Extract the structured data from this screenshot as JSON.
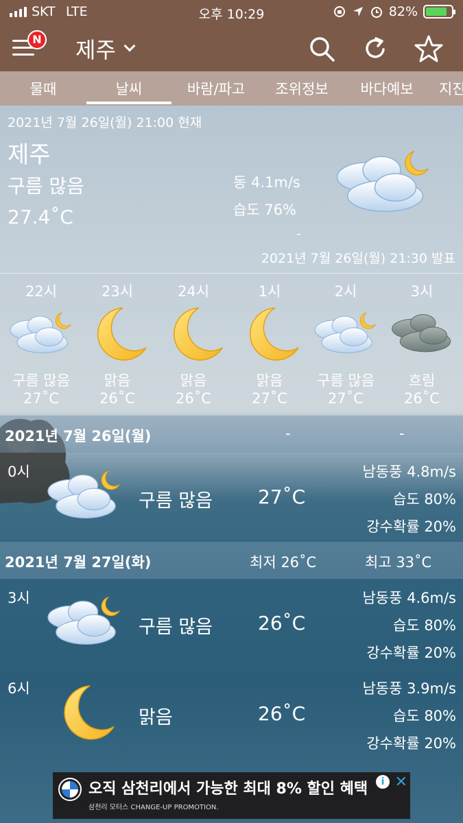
{
  "status_bar": {
    "carrier": "SKT",
    "network": "LTE",
    "time": "오후 10:29",
    "battery": "82%",
    "battery_level": 0.82
  },
  "header": {
    "notification_badge": "N",
    "city": "제주",
    "icons": [
      "menu-icon",
      "search-icon",
      "refresh-icon",
      "star-icon"
    ]
  },
  "tabs": [
    {
      "label": "물때"
    },
    {
      "label": "날씨",
      "active": true
    },
    {
      "label": "바람/파고"
    },
    {
      "label": "조위정보"
    },
    {
      "label": "바다예보"
    },
    {
      "label": "지진"
    }
  ],
  "current": {
    "datetime": "2021년 7월 26일(월) 21:00 현재",
    "city": "제주",
    "condition": "구름 많음",
    "temperature": "27.4˚C",
    "wind": "동 4.1m/s",
    "humidity": "습도 76%",
    "dash": "-",
    "issued": "2021년 7월 26일(월) 21:30 발표",
    "icon": "cloudy-night-icon"
  },
  "hourly": [
    {
      "hour": "22시",
      "condition": "구름 많음",
      "temp": "27˚C",
      "icon": "cloudy-night-icon"
    },
    {
      "hour": "23시",
      "condition": "맑음",
      "temp": "26˚C",
      "icon": "moon-icon"
    },
    {
      "hour": "24시",
      "condition": "맑음",
      "temp": "26˚C",
      "icon": "moon-icon"
    },
    {
      "hour": "1시",
      "condition": "맑음",
      "temp": "27˚C",
      "icon": "moon-icon"
    },
    {
      "hour": "2시",
      "condition": "구름 많음",
      "temp": "27˚C",
      "icon": "cloudy-night-icon"
    },
    {
      "hour": "3시",
      "condition": "흐림",
      "temp": "26˚C",
      "icon": "overcast-icon"
    }
  ],
  "days": [
    {
      "date": "2021년 7월 26일(월)",
      "low": "-",
      "high": "-",
      "rows": [
        {
          "hour": "0시",
          "condition": "구름 많음",
          "temp": "27˚C",
          "wind": "남동풍 4.8m/s",
          "humidity": "습도 80%",
          "precip": "강수확률 20%",
          "icon": "cloudy-night-icon"
        }
      ]
    },
    {
      "date": "2021년 7월 27일(화)",
      "low": "최저 26˚C",
      "high": "최고 33˚C",
      "rows": [
        {
          "hour": "3시",
          "condition": "구름 많음",
          "temp": "26˚C",
          "wind": "남동풍 4.6m/s",
          "humidity": "습도 80%",
          "precip": "강수확률 20%",
          "icon": "cloudy-night-icon"
        },
        {
          "hour": "6시",
          "condition": "맑음",
          "temp": "26˚C",
          "wind": "남동풍 3.9m/s",
          "humidity": "습도 80%",
          "precip": "강수확률 20%",
          "icon": "moon-icon"
        }
      ]
    }
  ],
  "ad": {
    "text": "오직 삼천리에서 가능한 최대 8% 할인 혜택",
    "subtext": "삼천리 모터스 CHANGE-UP PROMOTION.",
    "info": "i",
    "close": "✕"
  }
}
